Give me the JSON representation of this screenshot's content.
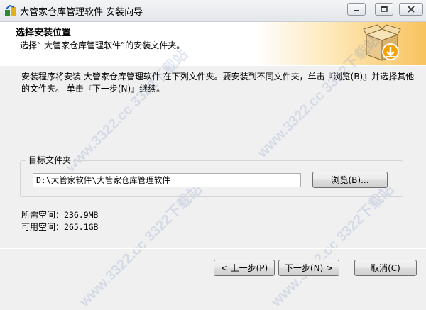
{
  "window": {
    "title": "大管家仓库管理软件 安装向导",
    "controls": {
      "minimize_icon": "minimize-icon",
      "maximize_icon": "maximize-icon",
      "close_icon": "close-icon"
    }
  },
  "header": {
    "title": "选择安装位置",
    "subtitle": "选择“ 大管家仓库管理软件”的安装文件夹。",
    "icon": "package-install-icon"
  },
  "description": "安装程序将安装  大管家仓库管理软件 在下列文件夹。要安装到不同文件夹，单击『浏览(B)』并选择其他的文件夹。 单击『下一步(N)』继续。",
  "destination": {
    "group_label": "目标文件夹",
    "path": "D:\\大管家软件\\大管家仓库管理软件",
    "browse_label": "浏览(B)..."
  },
  "space": {
    "required_label": "所需空间：",
    "required_value": "236.9MB",
    "available_label": "可用空间：",
    "available_value": "265.1GB"
  },
  "footer": {
    "back_label": "< 上一步(P)",
    "next_label": "下一步(N) >",
    "cancel_label": "取消(C)"
  },
  "watermark": "www.3322.cc  3322下载站",
  "colors": {
    "header_accent": "#f8c35e",
    "watermark": "#5a78be"
  }
}
